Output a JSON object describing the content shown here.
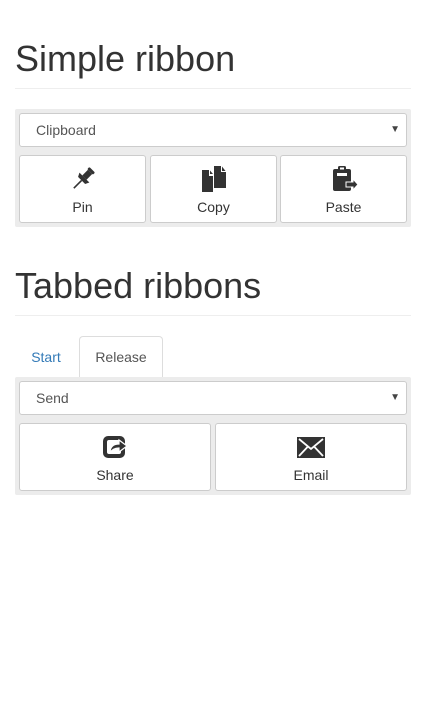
{
  "simple_ribbon": {
    "title": "Simple ribbon",
    "select_value": "Clipboard",
    "buttons": [
      {
        "label": "Pin",
        "icon": "pushpin-icon"
      },
      {
        "label": "Copy",
        "icon": "copy-icon"
      },
      {
        "label": "Paste",
        "icon": "paste-icon"
      }
    ]
  },
  "tabbed_ribbons": {
    "title": "Tabbed ribbons",
    "tabs": [
      {
        "label": "Start",
        "active": false
      },
      {
        "label": "Release",
        "active": true
      }
    ],
    "select_value": "Send",
    "buttons": [
      {
        "label": "Share",
        "icon": "share-icon"
      },
      {
        "label": "Email",
        "icon": "envelope-icon"
      }
    ]
  },
  "colors": {
    "text": "#333333",
    "link": "#337ab7",
    "ribbon_bg": "#ececec",
    "border": "#cccccc"
  }
}
